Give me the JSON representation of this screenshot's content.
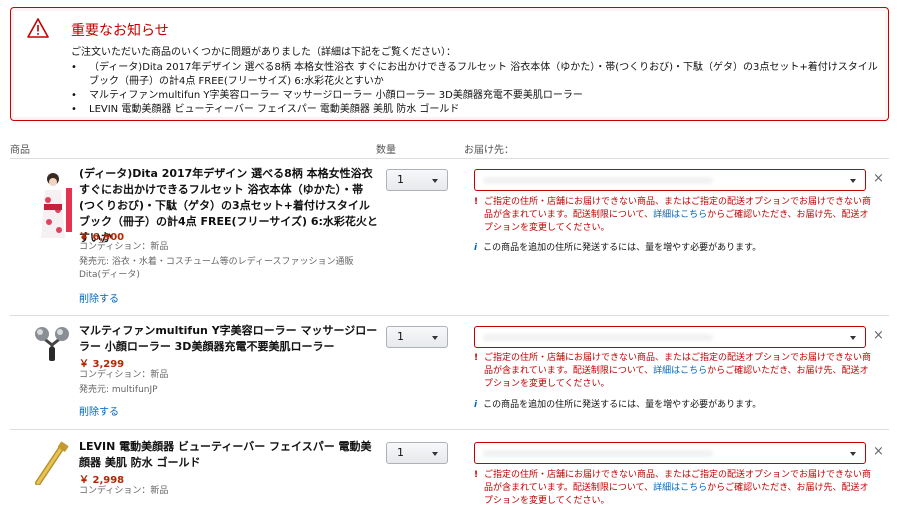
{
  "alert": {
    "title": "重要なお知らせ",
    "intro": "ご注文いただいた商品のいくつかに問題がありました（詳細は下記をご覧ください）：",
    "items": [
      "（ディータ)Dita 2017年デザイン 選べる8柄 本格女性浴衣 すぐにお出かけできるフルセット 浴衣本体（ゆかた）・帯(つくりおび)・下駄（ゲタ）の3点セット+着付けスタイルブック（冊子）の計4点 FREE(フリーサイズ) 6:水彩花火とすいか",
      "マルティファンmultifun Y字美容ローラー マッサージローラー 小顔ローラー 3D美顔器充電不要美肌ローラー",
      "LEVIN 電動美顔器 ビューティーバー フェイスパー 電動美顔器 美肌 防水 ゴールド"
    ]
  },
  "columns": {
    "product": "商品",
    "quantity": "数量",
    "delivery": "お届け先："
  },
  "error": {
    "pre": "ご指定の住所・店舗にお届けできない商品、またはご指定の配送オプションでお届けできない商品が含まれています。配送制限について、",
    "link": "詳細はこちら",
    "post": "からご確認いただき、お届け先、配送オプションを変更してください。"
  },
  "info_text": "この商品を追加の住所に発送するには、量を増やす必要があります。",
  "delete_label": "削除する",
  "close_glyph": "×",
  "items": [
    {
      "title": "(ディータ)Dita 2017年デザイン 選べる8柄 本格女性浴衣 すぐにお出かけできるフルセット 浴衣本体（ゆかた）・帯(つくりおび)・下駄（ゲタ）の3点セット+着付けスタイルブック（冊子）の計4点 FREE(フリーサイズ) 6:水彩花火とすいか",
      "price": "￥ 6,900",
      "condition": "コンディション：新品",
      "seller": "発売元: 浴衣・水着・コスチューム等のレディースファッション通販Dita(ディータ)",
      "quantity": "1"
    },
    {
      "title": "マルティファンmultifun Y字美容ローラー マッサージローラー 小顔ローラー 3D美顔器充電不要美肌ローラー",
      "price": "￥ 3,299",
      "condition": "コンディション：新品",
      "seller": "発売元: multifunJP",
      "quantity": "1"
    },
    {
      "title": "LEVIN 電動美顔器 ビューティーバー フェイスパー 電動美顔器 美肌 防水 ゴールド",
      "price": "￥ 2,998",
      "condition": "コンディション：新品",
      "quantity": "1"
    }
  ],
  "colors": {
    "alert_red": "#c40000",
    "price_red": "#b12704",
    "link_blue": "#0066c0"
  }
}
